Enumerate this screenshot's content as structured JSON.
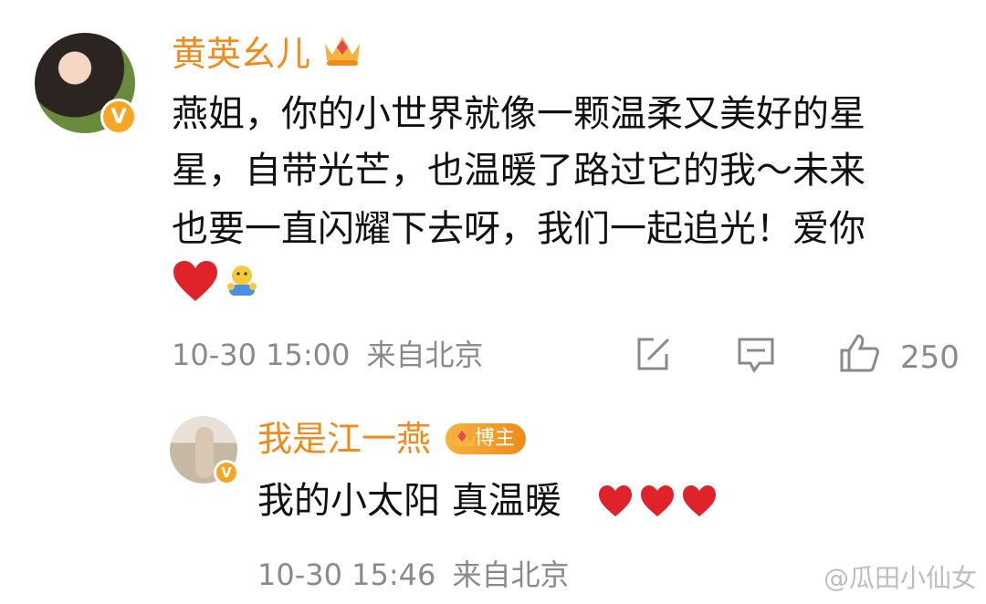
{
  "comment": {
    "username": "黄英幺儿",
    "lines": [
      "燕姐，你的小世界就像一颗温柔又美好的星",
      "星，自带光芒，也温暖了路过它的我～未来",
      "也要一直闪耀下去呀，我们一起追光！爱你"
    ],
    "emojis": [
      "❤️",
      "🙋"
    ],
    "timestamp": "10-30 15:00",
    "location": "来自北京",
    "likes": "250"
  },
  "reply": {
    "username": "我是江一燕",
    "host_badge": "博主",
    "text": "我的小太阳 真温暖",
    "emojis": "❤❤❤",
    "timestamp": "10-30 15:46",
    "location": "来自北京"
  },
  "watermark": "@瓜田小仙女",
  "colors": {
    "username": "#f08a1a",
    "meta": "#8a8a8a",
    "badge": "#f6a623"
  }
}
